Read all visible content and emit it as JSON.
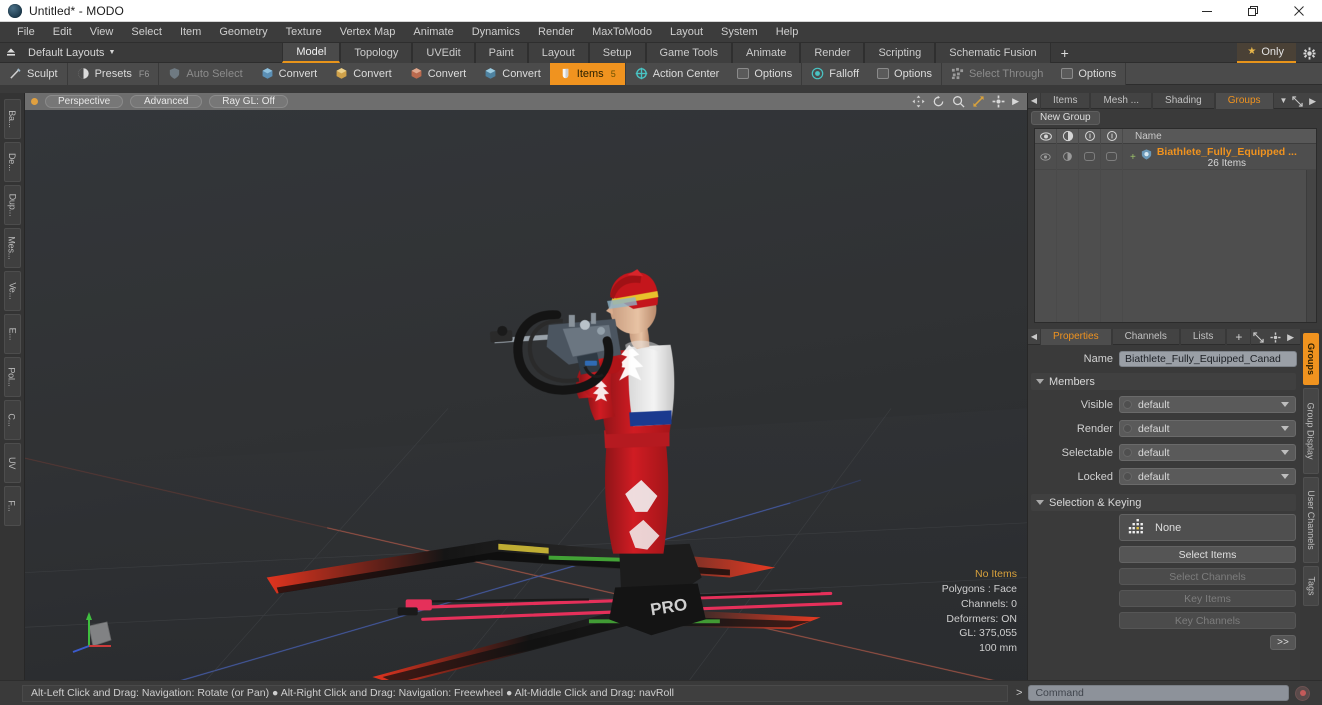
{
  "window": {
    "title": "Untitled* - MODO",
    "app_icon": "modo-logo-icon",
    "minimize": "minimize-icon",
    "maximize": "restore-icon",
    "close": "close-icon"
  },
  "menu": {
    "items": [
      "File",
      "Edit",
      "View",
      "Select",
      "Item",
      "Geometry",
      "Texture",
      "Vertex Map",
      "Animate",
      "Dynamics",
      "Render",
      "MaxToModo",
      "Layout",
      "System",
      "Help"
    ]
  },
  "layout_row": {
    "upload_icon": "upload-icon",
    "layouts_label": "Default Layouts",
    "tabs": [
      {
        "label": "Model",
        "active": true
      },
      {
        "label": "Topology",
        "active": false
      },
      {
        "label": "UVEdit",
        "active": false
      },
      {
        "label": "Paint",
        "active": false
      },
      {
        "label": "Layout",
        "active": false
      },
      {
        "label": "Setup",
        "active": false
      },
      {
        "label": "Game Tools",
        "active": false
      },
      {
        "label": "Animate",
        "active": false
      },
      {
        "label": "Render",
        "active": false
      },
      {
        "label": "Scripting",
        "active": false
      },
      {
        "label": "Schematic Fusion",
        "active": false
      }
    ],
    "add_tab": "+",
    "only_label": "Only",
    "only_star": "star-icon",
    "settings_icon": "gear-icon"
  },
  "toolbar": {
    "groups": [
      {
        "items": [
          {
            "label": "Sculpt",
            "icon": "brush-icon",
            "state": "normal",
            "kbd": ""
          }
        ]
      },
      {
        "items": [
          {
            "label": "Presets",
            "icon": "sphere-icon",
            "state": "normal",
            "kbd": "F6"
          }
        ]
      },
      {
        "items": [
          {
            "label": "Auto Select",
            "icon": "shield-icon",
            "state": "dim",
            "kbd": ""
          },
          {
            "label": "Convert",
            "icon": "cube-blue-icon",
            "state": "normal",
            "kbd": ""
          },
          {
            "label": "Convert",
            "icon": "cube-yellow-icon",
            "state": "normal",
            "kbd": ""
          },
          {
            "label": "Convert",
            "icon": "cube-red-icon",
            "state": "normal",
            "kbd": ""
          },
          {
            "label": "Convert",
            "icon": "cube-teal-icon",
            "state": "normal",
            "kbd": ""
          },
          {
            "label": "Items",
            "icon": "items-icon",
            "state": "active",
            "kbd": "5"
          }
        ]
      },
      {
        "items": [
          {
            "label": "Action Center",
            "icon": "crosshair-icon",
            "state": "normal",
            "kbd": ""
          },
          {
            "label": "Options",
            "icon": "square-icon",
            "state": "normal",
            "kbd": ""
          }
        ]
      },
      {
        "items": [
          {
            "label": "Falloff",
            "icon": "target-icon",
            "state": "normal",
            "kbd": ""
          },
          {
            "label": "Options",
            "icon": "square-icon",
            "state": "normal",
            "kbd": ""
          }
        ]
      },
      {
        "items": [
          {
            "label": "Select Through",
            "icon": "dots-icon",
            "state": "dim",
            "kbd": ""
          },
          {
            "label": "Options",
            "icon": "square-icon",
            "state": "normal",
            "kbd": ""
          }
        ]
      }
    ]
  },
  "left_strip": {
    "tabs": [
      "Ba...",
      "De...",
      "Dup...",
      "Mes...",
      "Ve...",
      "E...",
      "Pol...",
      "C...",
      "UV",
      "F..."
    ]
  },
  "viewport": {
    "header": {
      "dot": "viewport-indicator",
      "pills": [
        "Perspective",
        "Advanced",
        "Ray GL: Off"
      ],
      "icons": [
        "pan-icon",
        "rotate-icon",
        "zoom-icon",
        "fit-icon",
        "gear-icon",
        "chevron-right-icon"
      ]
    },
    "stats": {
      "selection": "No Items",
      "polygons": "Polygons : Face",
      "channels": "Channels: 0",
      "deformers": "Deformers: ON",
      "gl": "GL: 375,055",
      "scale": "100 mm"
    },
    "scene_description": "Biathlete 3D model in red and white Canadian uniform aiming a rifle, standing on skis with poles",
    "colors": {
      "x_axis": "#c4675a",
      "y_axis": "#6ac46a",
      "z_axis": "#5a78c4",
      "background": "#303235"
    }
  },
  "right_panel": {
    "tabs": [
      {
        "label": "Items",
        "active": false
      },
      {
        "label": "Mesh ...",
        "active": false
      },
      {
        "label": "Shading",
        "active": false
      },
      {
        "label": "Groups",
        "active": true
      }
    ],
    "new_group_button": "New Group",
    "list": {
      "header_icons": [
        "eye-icon",
        "render-icon",
        "info-a-icon",
        "info-b-icon"
      ],
      "name_column": "Name",
      "rows": [
        {
          "title": "Biathlete_Fully_Equipped ...",
          "subtitle": "26 Items",
          "icon": "group-icon",
          "expand": "+"
        }
      ]
    }
  },
  "properties": {
    "tabs": [
      {
        "label": "Properties",
        "active": true
      },
      {
        "label": "Channels",
        "active": false
      },
      {
        "label": "Lists",
        "active": false
      },
      {
        "label": "+",
        "active": false
      }
    ],
    "name_label": "Name",
    "name_value": "Biathlete_Fully_Equipped_Canad",
    "members_section": "Members",
    "fields": [
      {
        "label": "Visible",
        "value": "default"
      },
      {
        "label": "Render",
        "value": "default"
      },
      {
        "label": "Selectable",
        "value": "default"
      },
      {
        "label": "Locked",
        "value": "default"
      }
    ],
    "selection_section": "Selection & Keying",
    "none_value": "None",
    "none_icon": "selection-grid-icon",
    "buttons": [
      {
        "label": "Select Items",
        "disabled": false
      },
      {
        "label": "Select Channels",
        "disabled": true
      },
      {
        "label": "Key Items",
        "disabled": true
      },
      {
        "label": "Key Channels",
        "disabled": true
      }
    ],
    "more_button": ">>",
    "vtabs": [
      {
        "label": "Groups",
        "active": true
      },
      {
        "label": "Group Display",
        "active": false
      },
      {
        "label": "User Channels",
        "active": false
      },
      {
        "label": "Tags",
        "active": false
      }
    ]
  },
  "status_bar": {
    "hint": "Alt-Left Click and Drag: Navigation: Rotate (or Pan) ● Alt-Right Click and Drag: Navigation: Freewheel ● Alt-Middle Click and Drag: navRoll",
    "command_prompt": ">",
    "command_placeholder": "Command",
    "record_icon": "record-icon"
  }
}
